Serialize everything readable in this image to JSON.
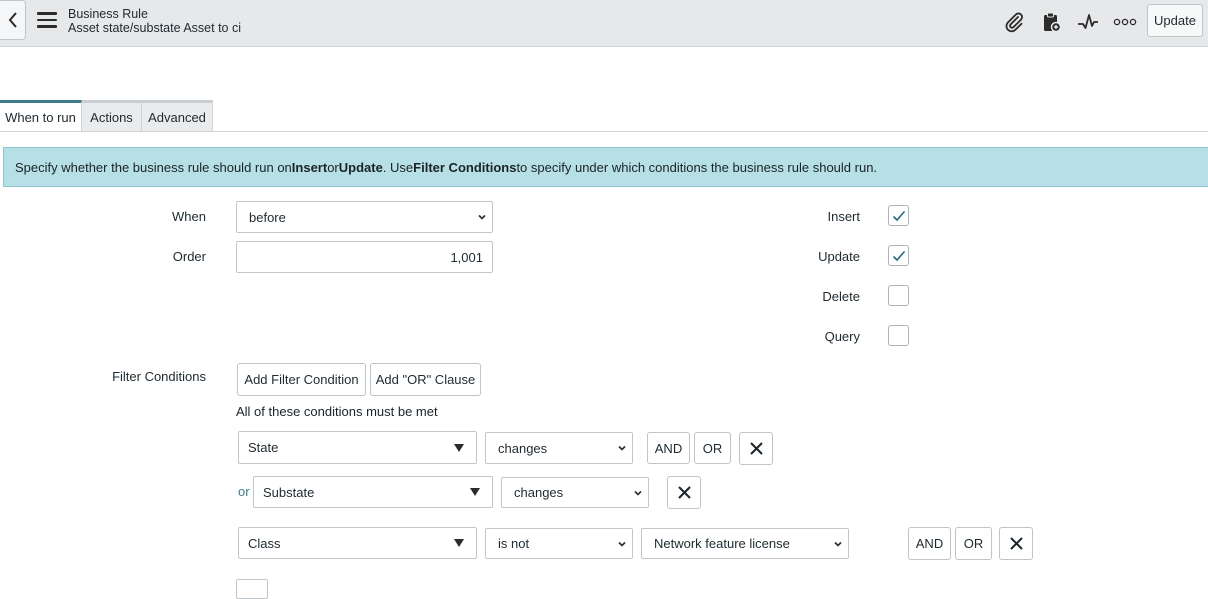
{
  "header": {
    "title": "Business Rule",
    "subtitle": "Asset state/substate Asset to ci",
    "update_label": "Update",
    "icons": [
      "paperclip-icon",
      "clipboard-icon",
      "activity-icon",
      "more-icon"
    ]
  },
  "tabs": [
    {
      "label": "When to run",
      "active": true
    },
    {
      "label": "Actions",
      "active": false
    },
    {
      "label": "Advanced",
      "active": false
    }
  ],
  "banner": {
    "p1": "Specify whether the business rule should run on ",
    "insert": "Insert",
    "p2": " or ",
    "update": "Update",
    "p3": ". Use ",
    "filter": "Filter Conditions",
    "p4": " to specify under which conditions the business rule should run."
  },
  "form": {
    "when_label": "When",
    "when_value": "before",
    "order_label": "Order",
    "order_value": "1,001",
    "checkboxes": [
      {
        "label": "Insert",
        "checked": true
      },
      {
        "label": "Update",
        "checked": true
      },
      {
        "label": "Delete",
        "checked": false
      },
      {
        "label": "Query",
        "checked": false
      }
    ],
    "filter_label": "Filter Conditions",
    "add_filter_label": "Add Filter Condition",
    "add_or_label": "Add \"OR\" Clause",
    "all_met_text": "All of these conditions must be met",
    "and_label": "AND",
    "or_label": "OR",
    "or_connector": "or",
    "conditions": [
      {
        "field": "State",
        "operator": "changes"
      },
      {
        "field": "Substate",
        "operator": "changes"
      },
      {
        "field": "Class",
        "operator": "is not",
        "value": "Network feature license"
      }
    ]
  },
  "colors": {
    "accent": "#3e7e8c",
    "banner": "#b6dfe6",
    "header": "#e6e8ea"
  }
}
